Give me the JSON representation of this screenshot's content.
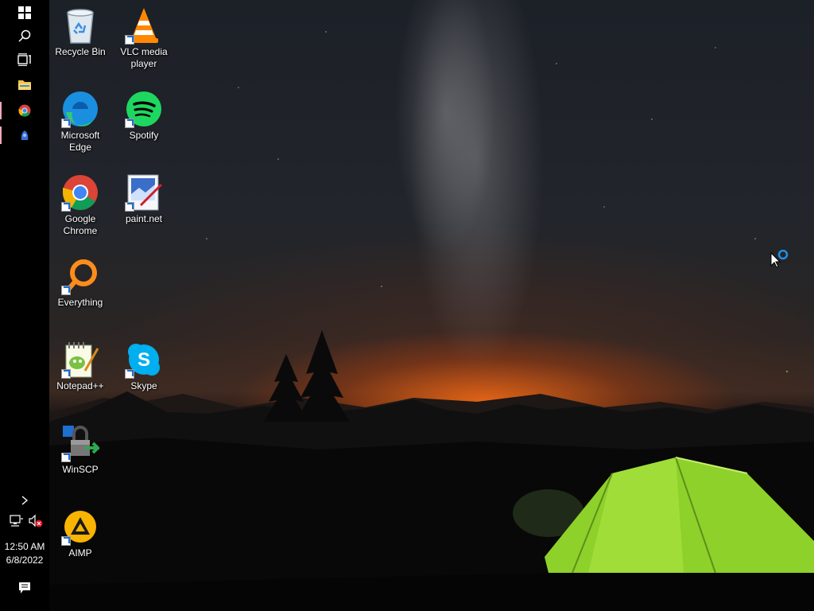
{
  "taskbar": {
    "buttons": [
      {
        "name": "start-button",
        "icon": "windows-logo-icon"
      },
      {
        "name": "search-button",
        "icon": "search-icon"
      },
      {
        "name": "task-view-button",
        "icon": "task-view-icon"
      },
      {
        "name": "file-explorer-button",
        "icon": "folder-icon"
      },
      {
        "name": "chrome-taskbar-button",
        "icon": "chrome-icon"
      },
      {
        "name": "app-taskbar-button",
        "icon": "app-icon"
      }
    ],
    "tray": {
      "chevron": "show-hidden-icons-icon",
      "network": "network-icon",
      "volume": "volume-muted-icon",
      "time": "12:50 AM",
      "date": "6/8/2022",
      "notifications": "action-center-icon"
    }
  },
  "desktop": {
    "icons": [
      {
        "label": "Recycle Bin",
        "icon": "recycle-bin-icon"
      },
      {
        "label": "VLC media player",
        "icon": "vlc-icon"
      },
      {
        "label": "Microsoft Edge",
        "icon": "edge-icon"
      },
      {
        "label": "Spotify",
        "icon": "spotify-icon"
      },
      {
        "label": "Google Chrome",
        "icon": "chrome-icon"
      },
      {
        "label": "paint.net",
        "icon": "paintnet-icon"
      },
      {
        "label": "Everything",
        "icon": "everything-icon"
      },
      {
        "label": "Notepad++",
        "icon": "notepadpp-icon"
      },
      {
        "label": "Skype",
        "icon": "skype-icon"
      },
      {
        "label": "WinSCP",
        "icon": "winscp-icon"
      },
      {
        "label": "AIMP",
        "icon": "aimp-icon"
      }
    ]
  },
  "colors": {
    "taskbar": "#000000",
    "accent": "#f4a7b9",
    "tent": "#8ed12a",
    "horizon": "#ff6e14"
  },
  "cursor": "busy-pointer-icon"
}
